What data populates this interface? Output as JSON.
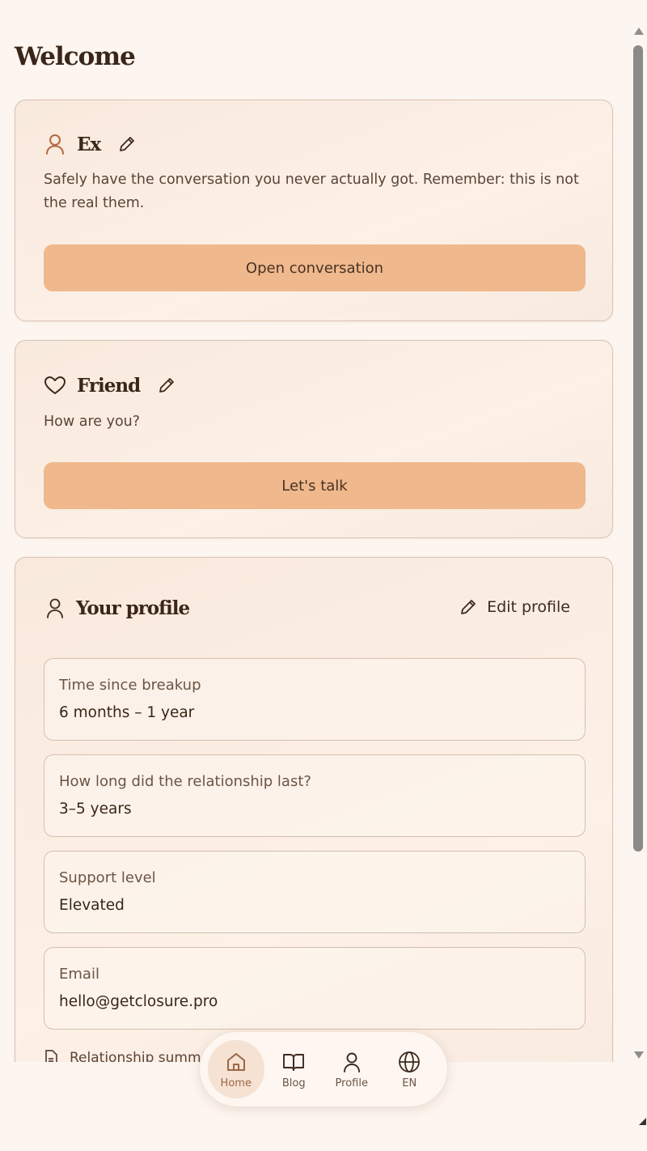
{
  "page": {
    "title": "Welcome"
  },
  "cards": {
    "ex": {
      "name": "Ex",
      "icon": "user-icon",
      "description": "Safely have the conversation you never actually got. Remember: this is not the real them.",
      "button_label": "Open conversation"
    },
    "friend": {
      "name": "Friend",
      "icon": "heart-icon",
      "description": "How are you?",
      "button_label": "Let's talk"
    }
  },
  "profile": {
    "title": "Your profile",
    "edit_label": "Edit profile",
    "fields": [
      {
        "label": "Time since breakup",
        "value": "6 months – 1 year"
      },
      {
        "label": "How long did the relationship last?",
        "value": "3–5 years"
      },
      {
        "label": "Support level",
        "value": "Elevated"
      },
      {
        "label": "Email",
        "value": "hello@getclosure.pro"
      }
    ],
    "summary_label": "Relationship summary"
  },
  "nav": {
    "items": [
      {
        "label": "Home",
        "icon": "home-icon",
        "active": true
      },
      {
        "label": "Blog",
        "icon": "book-icon",
        "active": false
      },
      {
        "label": "Profile",
        "icon": "user-icon",
        "active": false
      },
      {
        "label": "EN",
        "icon": "globe-icon",
        "active": false
      }
    ]
  },
  "colors": {
    "background": "#fdf5ef",
    "accent": "#efb98d",
    "text": "#3a2618",
    "active_nav": "#f6e2d3"
  }
}
